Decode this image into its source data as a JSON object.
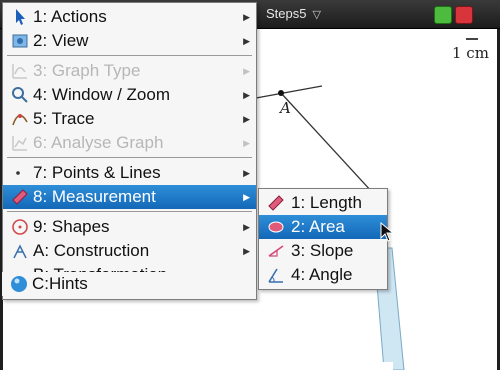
{
  "document": {
    "tab_title": "Steps5",
    "scale_label": "1 cm",
    "point_label": "A"
  },
  "menu": {
    "items": [
      {
        "label": "1: Actions",
        "icon": "pointer-icon",
        "disabled": false
      },
      {
        "label": "2: View",
        "icon": "view-icon",
        "disabled": false
      },
      {
        "label": "3: Graph Type",
        "icon": "graph-type-icon",
        "disabled": true
      },
      {
        "label": "4: Window / Zoom",
        "icon": "zoom-icon",
        "disabled": false
      },
      {
        "label": "5: Trace",
        "icon": "trace-icon",
        "disabled": false
      },
      {
        "label": "6: Analyse Graph",
        "icon": "analyse-graph-icon",
        "disabled": true
      },
      {
        "label": "7: Points & Lines",
        "icon": "points-lines-icon",
        "disabled": false
      },
      {
        "label": "8: Measurement",
        "icon": "measurement-icon",
        "disabled": false,
        "selected": true
      },
      {
        "label": "9: Shapes",
        "icon": "shapes-icon",
        "disabled": false
      },
      {
        "label": "A: Construction",
        "icon": "construction-icon",
        "disabled": false
      },
      {
        "label": "B: Transformation",
        "icon": "transformation-icon",
        "disabled": false
      },
      {
        "label": "C:Hints",
        "icon": "hints-icon",
        "disabled": false
      }
    ]
  },
  "submenu": {
    "items": [
      {
        "label": "1: Length",
        "icon": "ruler-icon"
      },
      {
        "label": "2: Area",
        "icon": "area-icon",
        "selected": true
      },
      {
        "label": "3: Slope",
        "icon": "slope-icon"
      },
      {
        "label": "4: Angle",
        "icon": "angle-icon"
      }
    ]
  },
  "colors": {
    "highlight": "#1e7ccb",
    "disabled_text": "#b7b7b7",
    "callout": "#cfe6f3"
  }
}
